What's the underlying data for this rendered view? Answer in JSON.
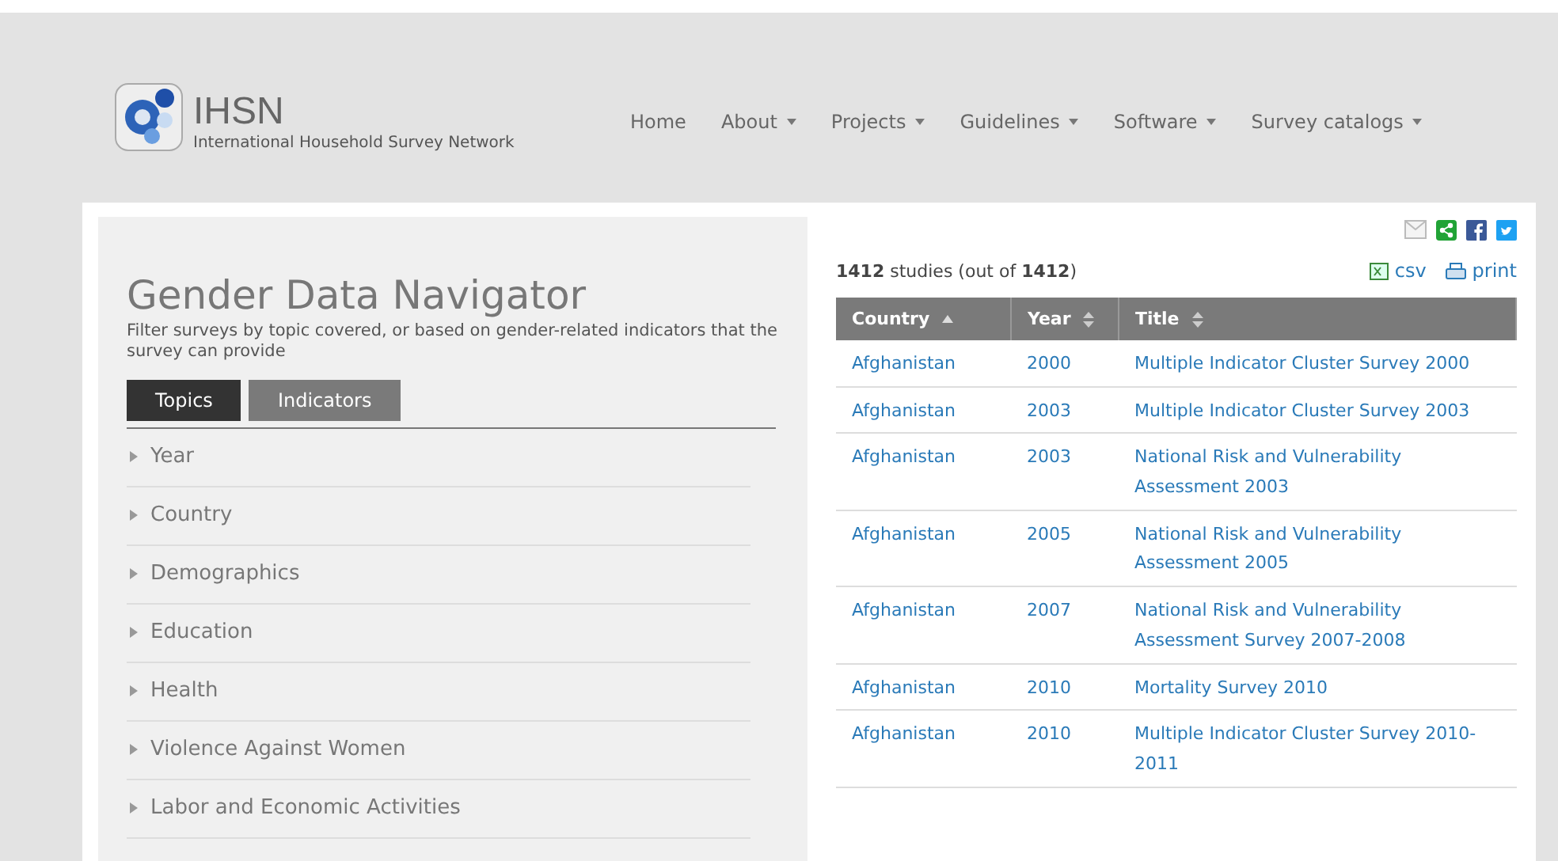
{
  "site": {
    "name": "IHSN",
    "tagline": "International Household Survey Network"
  },
  "nav": [
    {
      "label": "Home",
      "dropdown": false
    },
    {
      "label": "About",
      "dropdown": true
    },
    {
      "label": "Projects",
      "dropdown": true
    },
    {
      "label": "Guidelines",
      "dropdown": true
    },
    {
      "label": "Software",
      "dropdown": true
    },
    {
      "label": "Survey catalogs",
      "dropdown": true
    }
  ],
  "navigator": {
    "title": "Gender Data Navigator",
    "description": "Filter surveys by topic covered, or based on gender-related indicators that the survey can provide",
    "tabs": [
      {
        "label": "Topics",
        "selected": true
      },
      {
        "label": "Indicators",
        "selected": false
      }
    ],
    "topics": [
      {
        "label": "Year",
        "expanded": false
      },
      {
        "label": "Country",
        "expanded": false
      },
      {
        "label": "Demographics",
        "expanded": false
      },
      {
        "label": "Education",
        "expanded": false
      },
      {
        "label": "Health",
        "expanded": false
      },
      {
        "label": "Violence Against Women",
        "expanded": false
      },
      {
        "label": "Labor and Economic Activities",
        "expanded": false
      }
    ]
  },
  "results": {
    "count": "1412",
    "count_label": "studies (out of",
    "total": "1412",
    "close": ")",
    "export": [
      "csv",
      "print"
    ],
    "columns": [
      {
        "label": "Country",
        "sorted": true
      },
      {
        "label": "Year",
        "sorted": false
      },
      {
        "label": "Title",
        "sorted": false
      }
    ],
    "rows": [
      {
        "country": "Afghanistan",
        "year": "2000",
        "title": "Multiple Indicator Cluster Survey 2000"
      },
      {
        "country": "Afghanistan",
        "year": "2003",
        "title": "Multiple Indicator Cluster Survey 2003"
      },
      {
        "country": "Afghanistan",
        "year": "2003",
        "title": "National Risk and Vulnerability Assessment 2003"
      },
      {
        "country": "Afghanistan",
        "year": "2005",
        "title": "National Risk and Vulnerability Assessment 2005"
      },
      {
        "country": "Afghanistan",
        "year": "2007",
        "title": "National Risk and Vulnerability Assessment Survey 2007-2008"
      },
      {
        "country": "Afghanistan",
        "year": "2010",
        "title": "Mortality Survey 2010"
      },
      {
        "country": "Afghanistan",
        "year": "2010",
        "title": "Multiple Indicator Cluster Survey 2010-2011"
      }
    ]
  }
}
